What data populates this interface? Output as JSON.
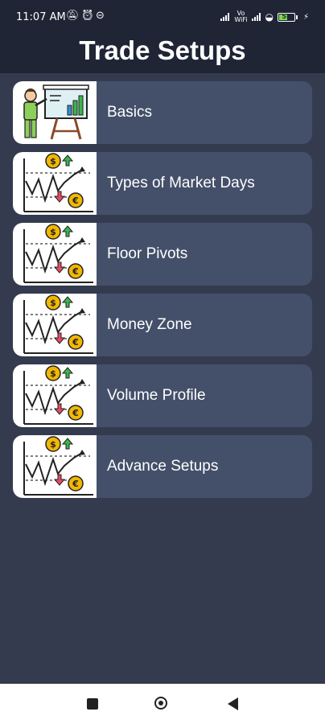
{
  "status": {
    "time": "11:07 AM",
    "volte": "Vo WiFi",
    "battery_level": "58"
  },
  "header": {
    "title": "Trade Setups"
  },
  "menu": {
    "items": [
      {
        "label": "Basics",
        "icon": "presentation-icon"
      },
      {
        "label": "Types of Market Days",
        "icon": "market-chart-icon"
      },
      {
        "label": "Floor Pivots",
        "icon": "market-chart-icon"
      },
      {
        "label": "Money Zone",
        "icon": "market-chart-icon"
      },
      {
        "label": "Volume Profile",
        "icon": "market-chart-icon"
      },
      {
        "label": "Advance Setups",
        "icon": "market-chart-icon"
      }
    ]
  },
  "nav": {
    "recents": "square-icon",
    "home": "circle-icon",
    "back": "triangle-back-icon"
  },
  "colors": {
    "background": "#343b4f",
    "header": "#1f2535",
    "card": "#44506a",
    "text": "#ffffff"
  }
}
